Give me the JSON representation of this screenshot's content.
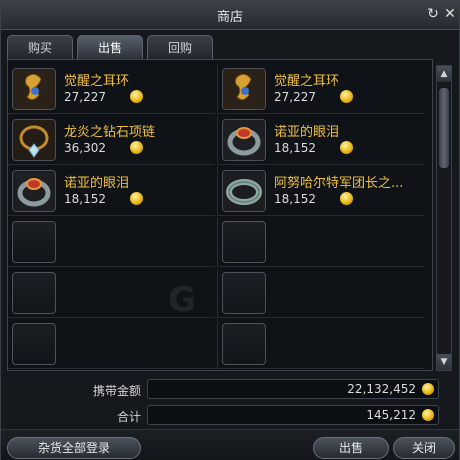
{
  "window": {
    "title": "商店"
  },
  "tabs": [
    {
      "label": "购买",
      "active": false
    },
    {
      "label": "出售",
      "active": true
    },
    {
      "label": "回购",
      "active": false
    }
  ],
  "items": [
    {
      "name": "觉醒之耳环",
      "price": "27,227",
      "icon": "earring-icon"
    },
    {
      "name": "觉醒之耳环",
      "price": "27,227",
      "icon": "earring-icon"
    },
    {
      "name": "龙炎之钻石项链",
      "price": "36,302",
      "icon": "necklace-icon"
    },
    {
      "name": "诺亚的眼泪",
      "price": "18,152",
      "icon": "ring-icon"
    },
    {
      "name": "诺亚的眼泪",
      "price": "18,152",
      "icon": "ring-icon"
    },
    {
      "name": "阿努哈尔特军团长之...",
      "price": "18,152",
      "icon": "ring-icon"
    }
  ],
  "summary": {
    "carry_label": "携带金额",
    "carry_value": "22,132,452",
    "total_label": "合计",
    "total_value": "145,212"
  },
  "buttons": {
    "register_all": "杂货全部登录",
    "sell": "出售",
    "close": "关闭"
  },
  "colors": {
    "item_name": "#f0c040",
    "coin": "#e6b30c"
  }
}
